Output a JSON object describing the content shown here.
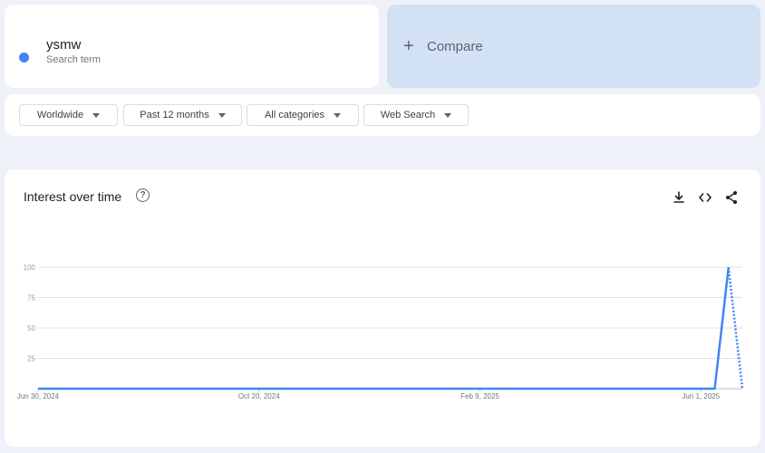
{
  "search_term": {
    "name": "ysmw",
    "subtitle": "Search term",
    "color": "#4285f4"
  },
  "compare": {
    "label": "Compare",
    "plus": "+"
  },
  "filters": {
    "region": "Worldwide",
    "time": "Past 12 months",
    "category": "All categories",
    "search_type": "Web Search"
  },
  "chart_panel": {
    "title": "Interest over time",
    "help_icon": "?",
    "tools": [
      "download-icon",
      "embed-code-icon",
      "share-icon"
    ]
  },
  "chart_data": {
    "type": "line",
    "title": "Interest over time",
    "xlabel": "",
    "ylabel": "",
    "ylim": [
      0,
      100
    ],
    "yticks": [
      25,
      50,
      75,
      100
    ],
    "x_tick_labels": [
      "Jun 30, 2024",
      "Oct 20, 2024",
      "Feb 9, 2025",
      "Jun 1, 2025"
    ],
    "grid": true,
    "series": [
      {
        "name": "ysmw",
        "color": "#4285f4",
        "points": [
          {
            "x": "2024-06-30",
            "y": 0
          },
          {
            "x": "2025-06-08",
            "y": 0
          },
          {
            "x": "2025-06-15",
            "y": 100
          }
        ],
        "partial_points": [
          {
            "x": "2025-06-15",
            "y": 100
          },
          {
            "x": "2025-06-22",
            "y": 0
          }
        ]
      }
    ]
  }
}
